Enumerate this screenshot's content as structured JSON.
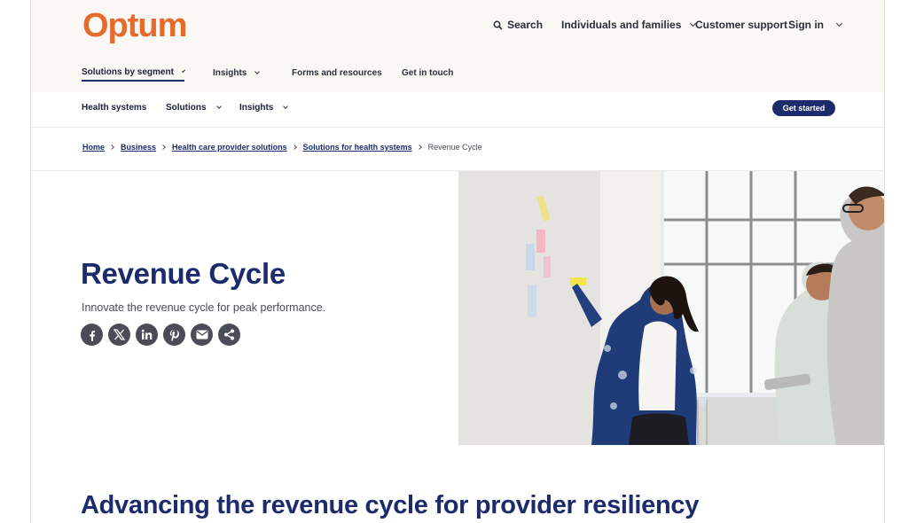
{
  "header": {
    "logo": "Optum",
    "search_label": "Search",
    "util_links": [
      {
        "label": "Individuals and families",
        "dropdown": true
      },
      {
        "label": "Customer support",
        "dropdown": false
      },
      {
        "label": "Sign in",
        "dropdown": true
      }
    ]
  },
  "primary_nav": [
    {
      "label": "Solutions by segment",
      "dropdown": true,
      "active": true
    },
    {
      "label": "Insights",
      "dropdown": true,
      "active": false
    },
    {
      "label": "Forms and resources",
      "dropdown": false,
      "active": false
    },
    {
      "label": "Get in touch",
      "dropdown": false,
      "active": false
    }
  ],
  "sub_nav": {
    "items": [
      {
        "label": "Health systems",
        "dropdown": false
      },
      {
        "label": "Solutions",
        "dropdown": true
      },
      {
        "label": "Insights",
        "dropdown": true
      }
    ],
    "cta_label": "Get started"
  },
  "breadcrumb": {
    "links": [
      "Home",
      "Business",
      "Health care provider solutions",
      "Solutions for health systems"
    ],
    "current": "Revenue Cycle"
  },
  "hero": {
    "title": "Revenue Cycle",
    "subtitle": "Innovate the revenue cycle for peak performance.",
    "share_icons": [
      "facebook-icon",
      "x-icon",
      "linkedin-icon",
      "pinterest-icon",
      "email-icon",
      "share-icon"
    ]
  },
  "section": {
    "title": "Advancing the revenue cycle for provider resiliency"
  },
  "colors": {
    "brand_orange": "#e76a2d",
    "navy": "#1c2b6b",
    "header_bg": "#f9f8f4"
  }
}
